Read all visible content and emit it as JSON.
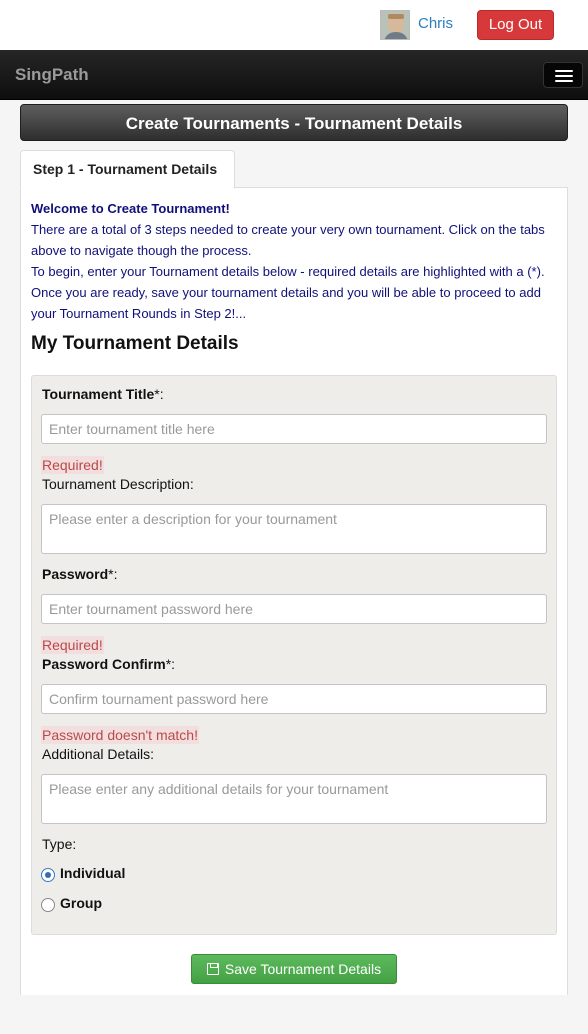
{
  "topbar": {
    "user_name": "Chris",
    "logout_label": "Log Out"
  },
  "navbar": {
    "brand": "SingPath"
  },
  "page": {
    "header": "Create Tournaments - Tournament Details",
    "tab_label": "Step 1 - Tournament Details"
  },
  "intro": {
    "welcome": "Welcome to Create Tournament!",
    "line1": "There are a total of 3 steps needed to create your very own tournament. Click on the tabs above to navigate though the process.",
    "line2": "To begin, enter your Tournament details below - required details are highlighted with a (*). Once you are ready, save your tournament details and you will be able to proceed to add your Tournament Rounds in Step 2!..."
  },
  "form": {
    "section_title": "My Tournament Details",
    "title_label": "Tournament Title",
    "title_placeholder": "Enter tournament title here",
    "title_error": "Required!",
    "description_label": "Tournament Description:",
    "description_placeholder": "Please enter a description for your tournament",
    "password_label": "Password",
    "password_placeholder": "Enter tournament password here",
    "password_error": "Required!",
    "confirm_label": "Password Confirm",
    "confirm_placeholder": "Confirm tournament password here",
    "confirm_error": "Password doesn't match!",
    "additional_label": "Additional Details:",
    "additional_placeholder": "Please enter any additional details for your tournament",
    "required_mark": "*:",
    "type_label": "Type:",
    "type_options": [
      "Individual",
      "Group"
    ],
    "type_selected": "Individual",
    "save_label": "Save Tournament Details"
  },
  "colors": {
    "intro_text": "#10107a",
    "error_text": "#b94a48",
    "error_bg": "#f2dede",
    "logout": "#d7393a",
    "save": "#4cae4c",
    "link": "#2a7fc1"
  },
  "icons": {
    "avatar": "user-photo",
    "menu": "hamburger-icon",
    "save": "save-icon"
  }
}
